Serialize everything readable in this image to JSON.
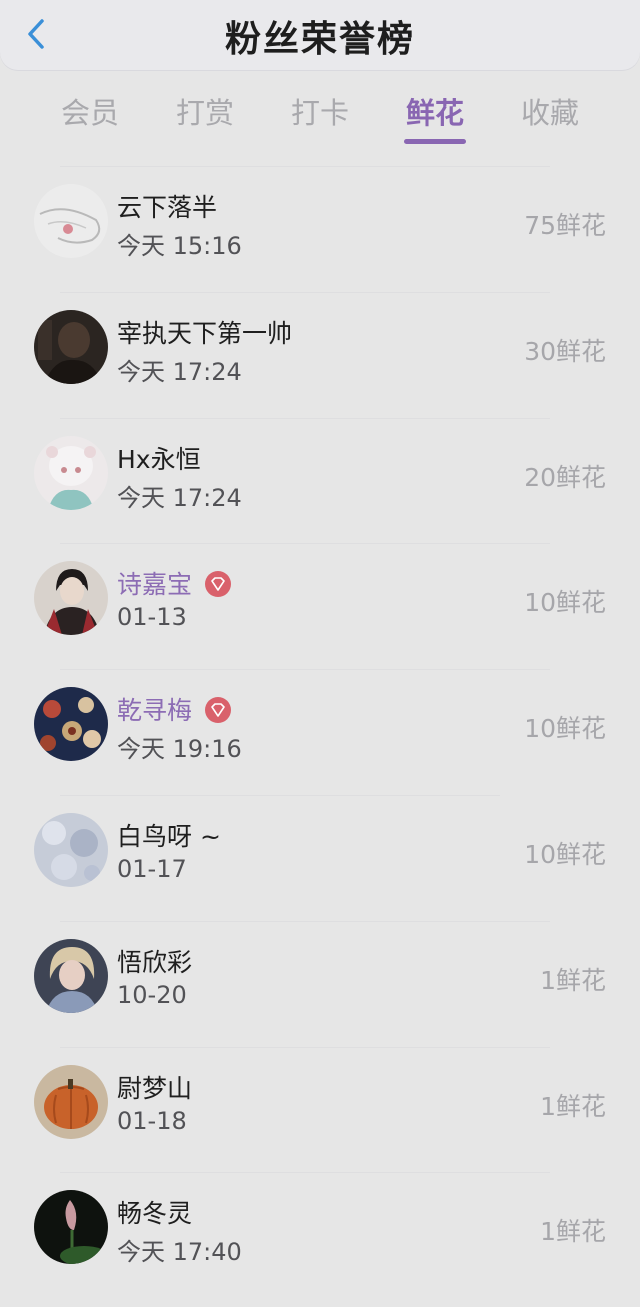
{
  "header": {
    "title": "粉丝荣誉榜"
  },
  "tabs": [
    {
      "label": "会员",
      "active": false
    },
    {
      "label": "打赏",
      "active": false
    },
    {
      "label": "打卡",
      "active": false
    },
    {
      "label": "鲜花",
      "active": true
    },
    {
      "label": "收藏",
      "active": false
    }
  ],
  "colors": {
    "accent": "#8966b2",
    "vip_name": "#8c6cb4",
    "vip_badge": "#d9616b",
    "inactive_tab": "#a9a9ad"
  },
  "fans": [
    {
      "name": "云下落半",
      "time": "今天 15:16",
      "count": "75鲜花",
      "vip": false,
      "avatar": "sketch-avatar"
    },
    {
      "name": "宰执天下第一帅",
      "time": "今天 17:24",
      "count": "30鲜花",
      "vip": false,
      "avatar": "dark-portrait-avatar"
    },
    {
      "name": "Hx永恒",
      "time": "今天 17:24",
      "count": "20鲜花",
      "vip": false,
      "avatar": "anime-girl-avatar"
    },
    {
      "name": "诗嘉宝",
      "time": "01-13",
      "count": "10鲜花",
      "vip": true,
      "avatar": "anime-boy-avatar"
    },
    {
      "name": "乾寻梅",
      "time": "今天 19:16",
      "count": "10鲜花",
      "vip": true,
      "avatar": "floral-pattern-avatar"
    },
    {
      "name": "白鸟呀 ~",
      "time": "01-17",
      "count": "10鲜花",
      "vip": false,
      "avatar": "blue-pastel-avatar"
    },
    {
      "name": "悟欣彩",
      "time": "10-20",
      "count": "1鲜花",
      "vip": false,
      "avatar": "blonde-girl-avatar"
    },
    {
      "name": "尉梦山",
      "time": "01-18",
      "count": "1鲜花",
      "vip": false,
      "avatar": "pumpkin-avatar"
    },
    {
      "name": "畅冬灵",
      "time": "今天 17:40",
      "count": "1鲜花",
      "vip": false,
      "avatar": "lotus-bud-avatar"
    }
  ]
}
